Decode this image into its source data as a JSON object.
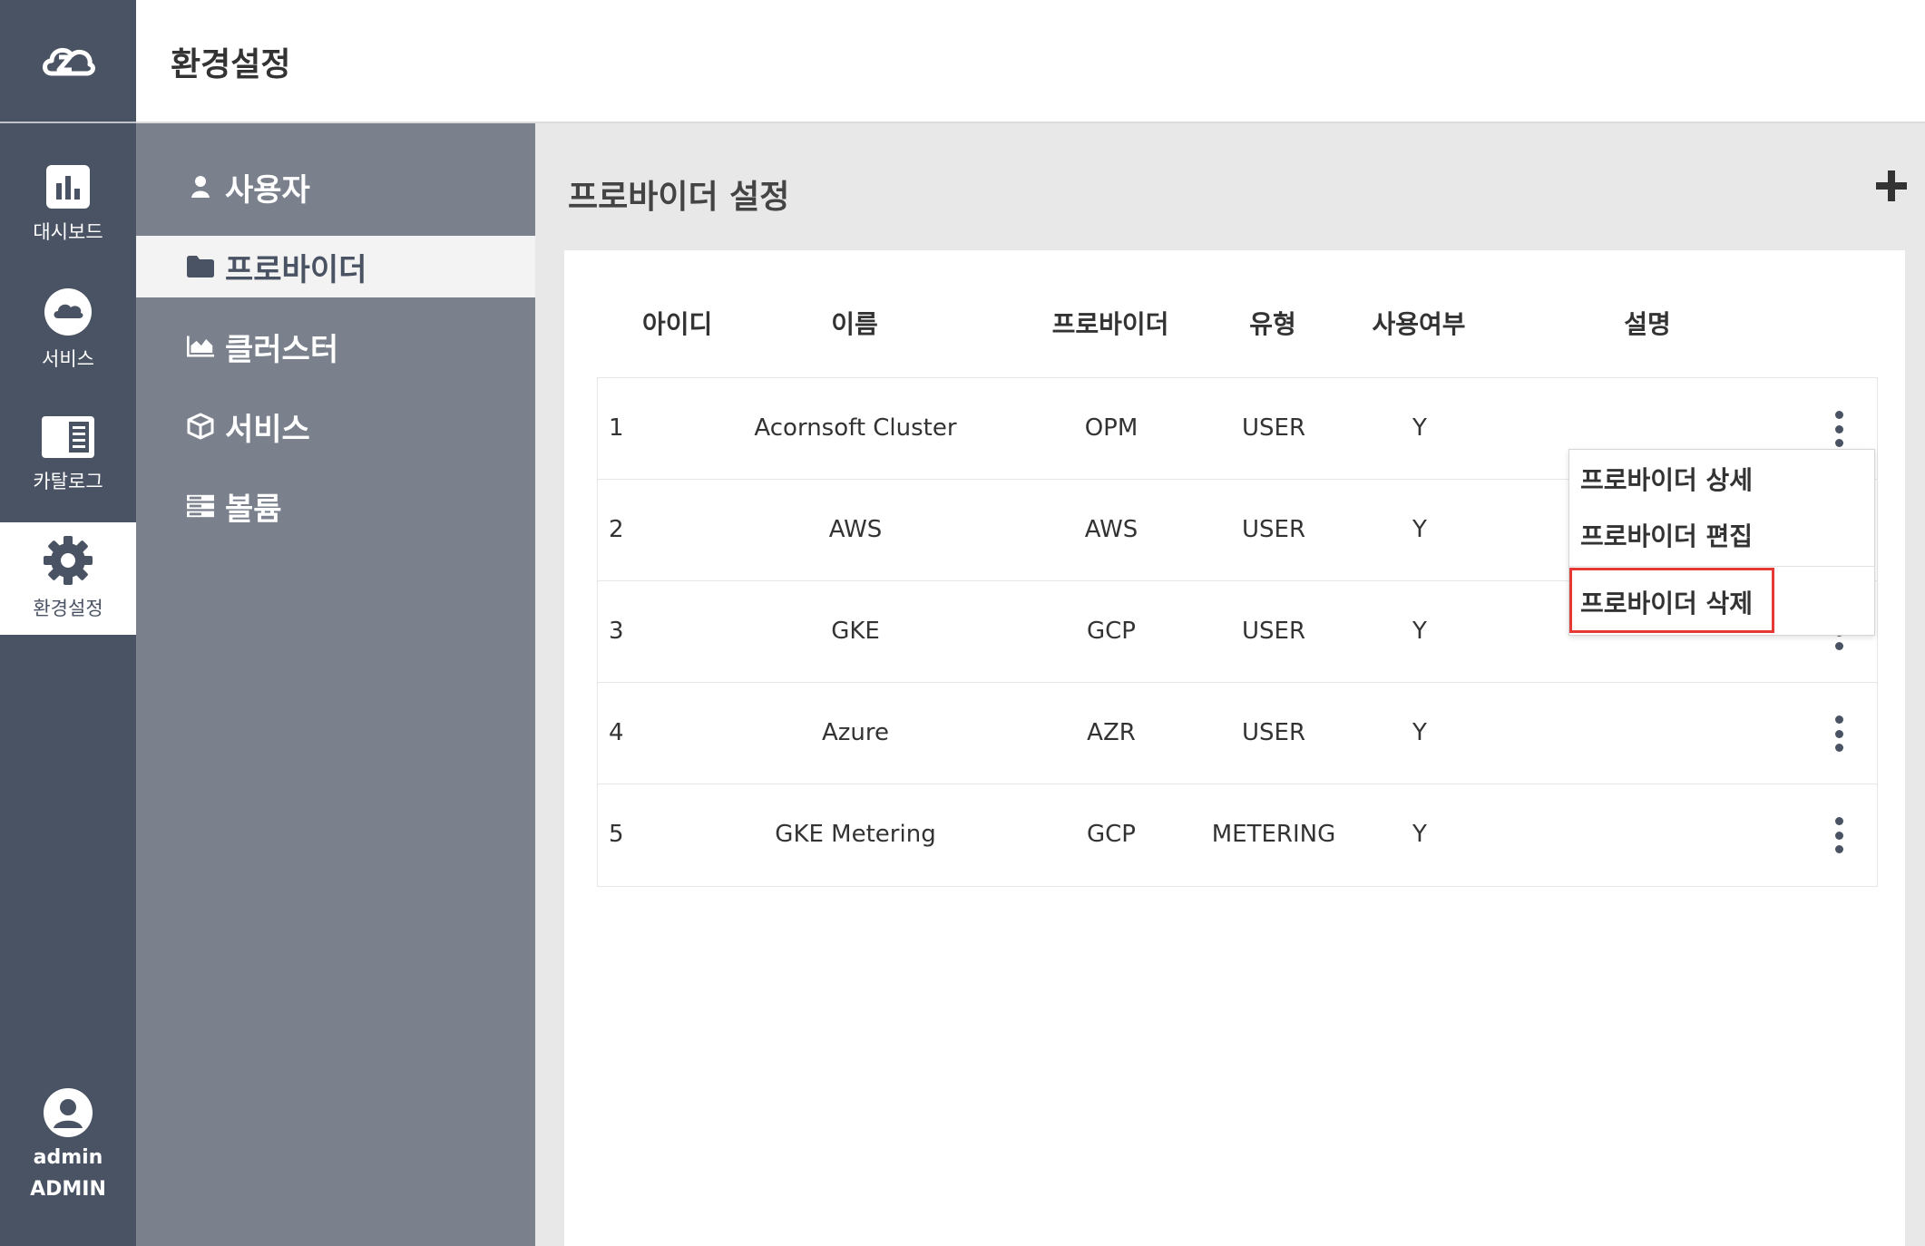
{
  "header": {
    "title": "환경설정"
  },
  "rail": {
    "items": [
      {
        "label": "대시보드",
        "icon": "bar-chart-icon"
      },
      {
        "label": "서비스",
        "icon": "cloud-icon"
      },
      {
        "label": "카탈로그",
        "icon": "catalog-icon"
      },
      {
        "label": "환경설정",
        "icon": "gear-icon",
        "active": true
      }
    ],
    "user": {
      "name": "admin",
      "role": "ADMIN"
    }
  },
  "subnav": {
    "items": [
      {
        "label": "사용자",
        "icon": "user-icon"
      },
      {
        "label": "프로바이더",
        "icon": "folder-icon",
        "active": true
      },
      {
        "label": "클러스터",
        "icon": "area-chart-icon"
      },
      {
        "label": "서비스",
        "icon": "cube-icon"
      },
      {
        "label": "볼륨",
        "icon": "server-icon"
      }
    ]
  },
  "main": {
    "title": "프로바이더 설정",
    "columns": [
      "아이디",
      "이름",
      "프로바이더",
      "유형",
      "사용여부",
      "설명"
    ],
    "rows": [
      {
        "id": "1",
        "name": "Acornsoft Cluster",
        "provider": "OPM",
        "type": "USER",
        "enabled": "Y",
        "desc": ""
      },
      {
        "id": "2",
        "name": "AWS",
        "provider": "AWS",
        "type": "USER",
        "enabled": "Y",
        "desc": ""
      },
      {
        "id": "3",
        "name": "GKE",
        "provider": "GCP",
        "type": "USER",
        "enabled": "Y",
        "desc": ""
      },
      {
        "id": "4",
        "name": "Azure",
        "provider": "AZR",
        "type": "USER",
        "enabled": "Y",
        "desc": ""
      },
      {
        "id": "5",
        "name": "GKE Metering",
        "provider": "GCP",
        "type": "METERING",
        "enabled": "Y",
        "desc": ""
      }
    ]
  },
  "dropdown": {
    "items": [
      "프로바이더 상세",
      "프로바이더 편집",
      "프로바이더 삭제"
    ],
    "highlight_color": "#e53935"
  },
  "colors": {
    "rail_bg": "#4a5363",
    "subnav_bg": "#7a818c",
    "main_bg": "#e8e8e8"
  }
}
